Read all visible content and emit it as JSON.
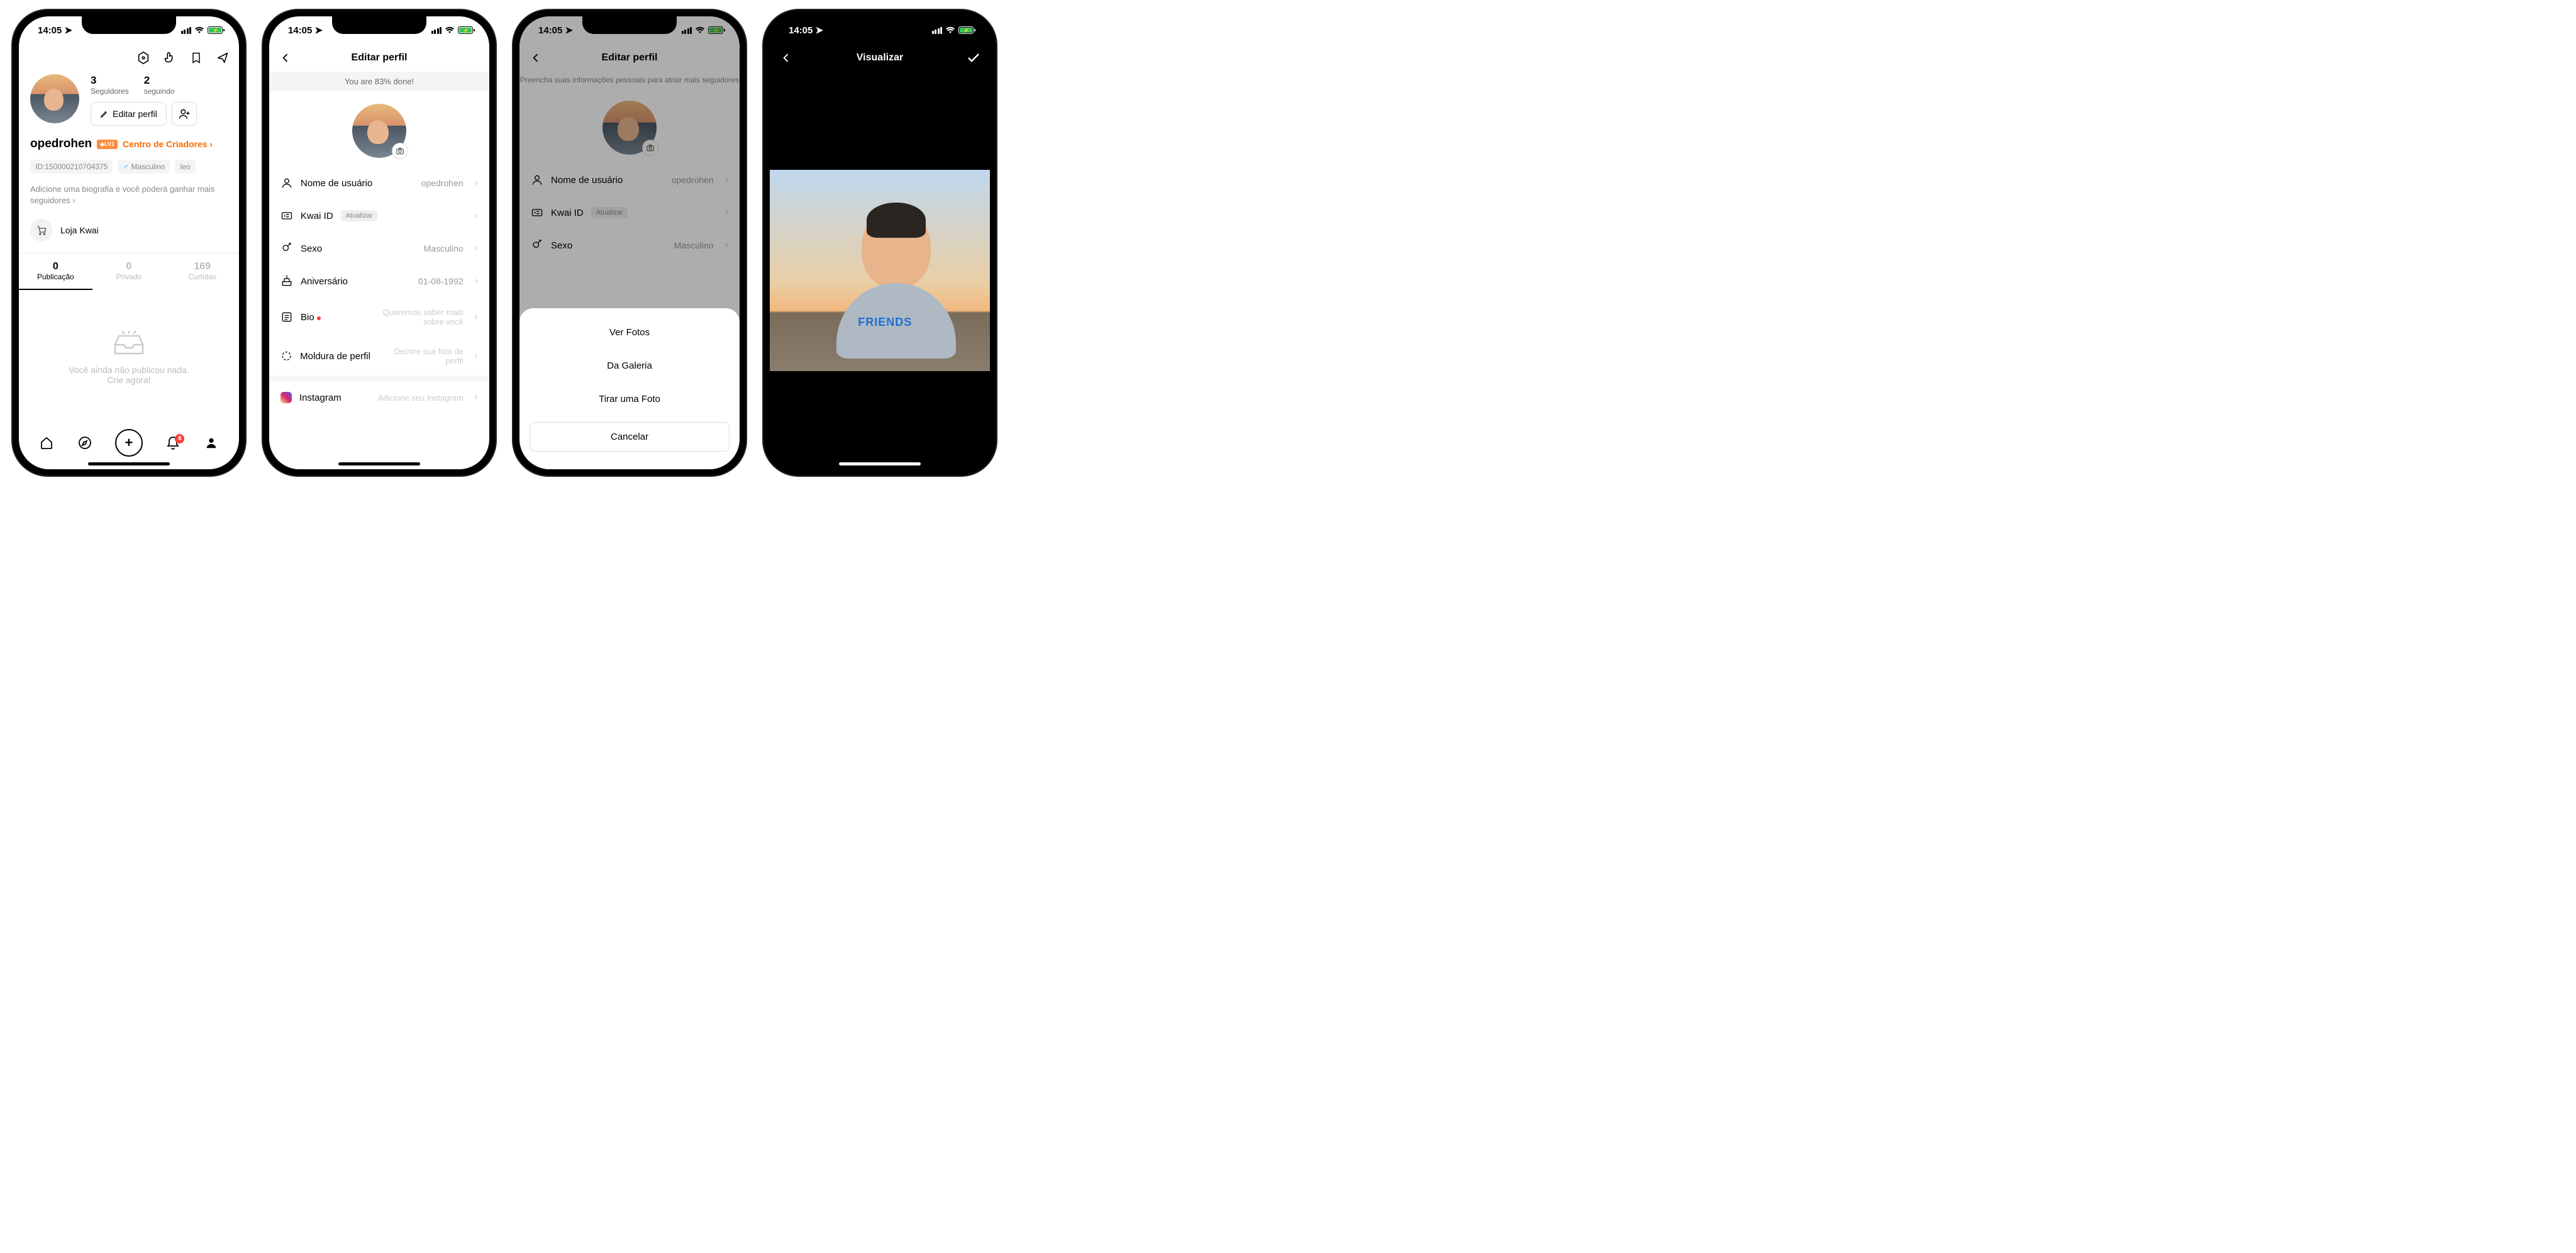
{
  "status": {
    "time": "14:05",
    "notif_count": "8"
  },
  "s1": {
    "followers_n": "3",
    "followers_l": "Seguidores",
    "following_n": "2",
    "following_l": "seguindo",
    "edit": "Editar perfil",
    "username": "opedrohen",
    "badge": "LV1",
    "creator": "Centro de Criadores",
    "id": "ID:150000210704375",
    "gender": "Masculino",
    "sign": "leo",
    "bio_tip": "Adicione uma biografia e você poderá ganhar mais seguidores",
    "store": "Loja Kwai",
    "t1n": "0",
    "t1l": "Publicação",
    "t2n": "0",
    "t2l": "Privado",
    "t3n": "169",
    "t3l": "Curtidas",
    "empty1": "Você ainda não publicou nada.",
    "empty2": "Crie agora!"
  },
  "s2": {
    "title": "Editar perfil",
    "banner": "You are 83% done!",
    "r_user": "Nome de usuário",
    "v_user": "opedrohen",
    "r_kwai": "Kwai ID",
    "pill": "Atualizar",
    "r_sex": "Sexo",
    "v_sex": "Masculino",
    "r_bday": "Aniversário",
    "v_bday": "01-08-1992",
    "r_bio": "Bio",
    "h_bio": "Queremos saber mais sobre você",
    "r_frame": "Moldura de perfil",
    "h_frame": "Decore sua foto de perfil",
    "r_ig": "Instagram",
    "h_ig": "Adicione seu Instagram"
  },
  "s3": {
    "info": "Preencha suas informações pessoais para atrair mais seguidores",
    "o1": "Ver Fotos",
    "o2": "Da Galeria",
    "o3": "Tirar uma Foto",
    "cancel": "Cancelar"
  },
  "s4": {
    "title": "Visualizar",
    "tee": "FRIENDS"
  }
}
